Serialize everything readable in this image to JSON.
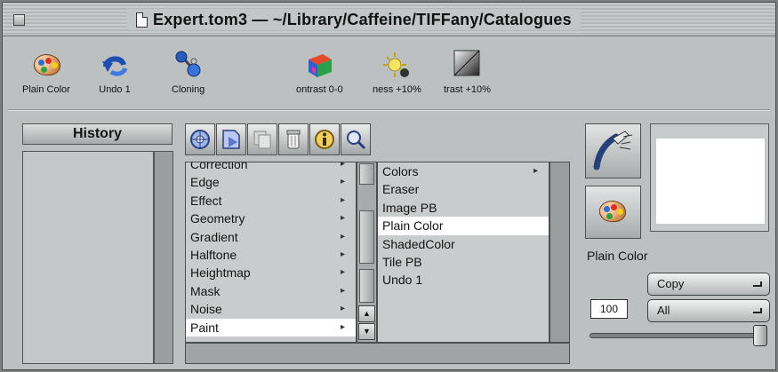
{
  "window": {
    "title": "Expert.tom3 — ~/Library/Caffeine/TIFFany/Catalogues"
  },
  "toolbar": {
    "items": [
      {
        "label": "Plain Color",
        "icon": "palette-icon"
      },
      {
        "label": "Undo 1",
        "icon": "undo-icon"
      },
      {
        "label": "Cloning",
        "icon": "cloning-icon"
      },
      {
        "label": "ontrast 0-0",
        "icon": "contrast-cube-icon"
      },
      {
        "label": "ness +10%",
        "icon": "brightness-sparkle-icon"
      },
      {
        "label": "trast +10%",
        "icon": "contrast-gradient-icon"
      }
    ]
  },
  "history": {
    "header": "History",
    "items": []
  },
  "icon_row": [
    "gear-icon",
    "page-arrow-icon",
    "copy-icon",
    "trash-can-icon",
    "info-icon",
    "magnifier-icon"
  ],
  "browser": {
    "column1": [
      {
        "label": "Correction",
        "has_children": true
      },
      {
        "label": "Edge",
        "has_children": true
      },
      {
        "label": "Effect",
        "has_children": true
      },
      {
        "label": "Geometry",
        "has_children": true
      },
      {
        "label": "Gradient",
        "has_children": true
      },
      {
        "label": "Halftone",
        "has_children": true
      },
      {
        "label": "Heightmap",
        "has_children": true
      },
      {
        "label": "Mask",
        "has_children": true
      },
      {
        "label": "Noise",
        "has_children": true
      },
      {
        "label": "Paint",
        "has_children": true,
        "selected": true
      }
    ],
    "column2": [
      {
        "label": "Colors",
        "has_children": true
      },
      {
        "label": "Eraser"
      },
      {
        "label": "Image PB"
      },
      {
        "label": "Plain Color",
        "selected": true
      },
      {
        "label": "ShadedColor"
      },
      {
        "label": "Tile PB"
      },
      {
        "label": "Undo 1"
      }
    ]
  },
  "right_panel": {
    "tool_name": "Plain Color",
    "mode_select": "Copy",
    "channel_select": "All",
    "opacity_value": "100",
    "opacity_fraction": 1.0
  },
  "colors": {
    "window_bg": "#bcc0c0",
    "selection": "#ffffff",
    "border": "#4c4e4e"
  }
}
